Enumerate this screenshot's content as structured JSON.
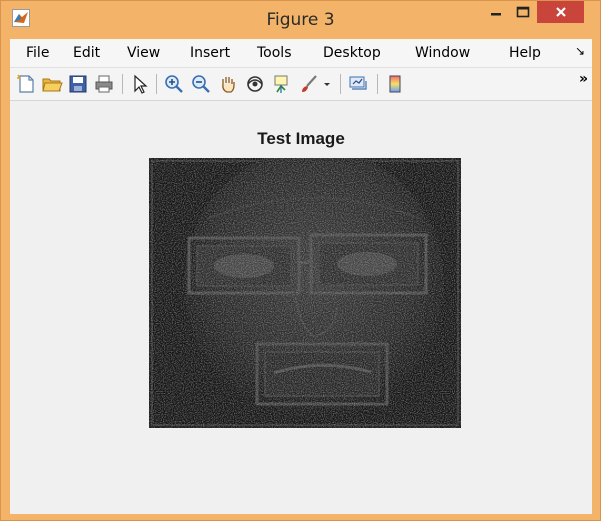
{
  "window": {
    "title": "Figure 3"
  },
  "menu": {
    "items": [
      "File",
      "Edit",
      "View",
      "Insert",
      "Tools",
      "Desktop",
      "Window",
      "Help"
    ]
  },
  "toolbar": {
    "icons": [
      "new-figure-icon",
      "open-file-icon",
      "save-icon",
      "print-icon",
      "pointer-icon",
      "zoom-in-icon",
      "zoom-out-icon",
      "pan-hand-icon",
      "rotate-3d-icon",
      "data-cursor-icon",
      "brush-icon",
      "brush-dropdown-icon",
      "link-plot-icon",
      "colorbar-icon"
    ]
  },
  "figure": {
    "axes_title": "Test Image"
  },
  "colors": {
    "title_bar": "#f3b469",
    "close_button": "#c9453b",
    "client_bg": "#f0f0f0",
    "image_bg": "#1b1b1b"
  }
}
